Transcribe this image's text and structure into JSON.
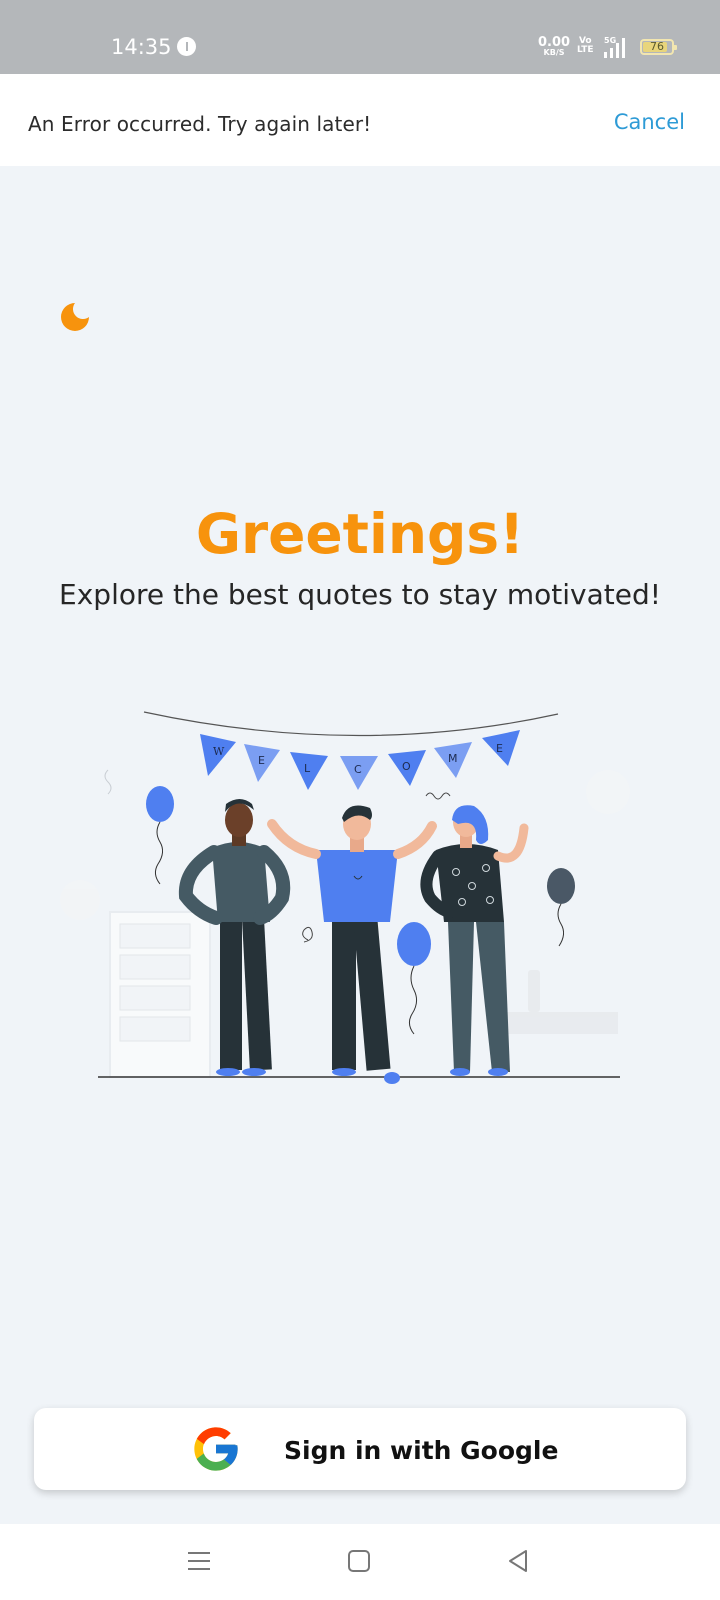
{
  "status_bar": {
    "time": "14:35",
    "net_speed_value": "0.00",
    "net_speed_unit": "KB/S",
    "volte_top": "Vo",
    "volte_bottom": "LTE",
    "network": "5G",
    "battery": "76",
    "icons": [
      "info-icon",
      "volte-icon",
      "signal-icon",
      "battery-icon"
    ]
  },
  "error_banner": {
    "message": "An Error occurred. Try again later!",
    "cancel_label": "Cancel"
  },
  "main": {
    "mode_icon": "moon-icon",
    "title": "Greetings!",
    "subtitle": "Explore the best quotes to stay motivated!",
    "illustration": {
      "banner_letters": [
        "W",
        "E",
        "L",
        "C",
        "O",
        "M",
        "E"
      ]
    }
  },
  "signin": {
    "label": "Sign in with Google",
    "icon": "google-icon"
  },
  "nav_bar": {
    "icons": [
      "menu-icon",
      "home-icon",
      "back-icon"
    ]
  },
  "colors": {
    "accent": "#f7930d",
    "link": "#2e9bd6",
    "background": "#f0f4f8",
    "illustration_blue": "#4f7ff0"
  }
}
